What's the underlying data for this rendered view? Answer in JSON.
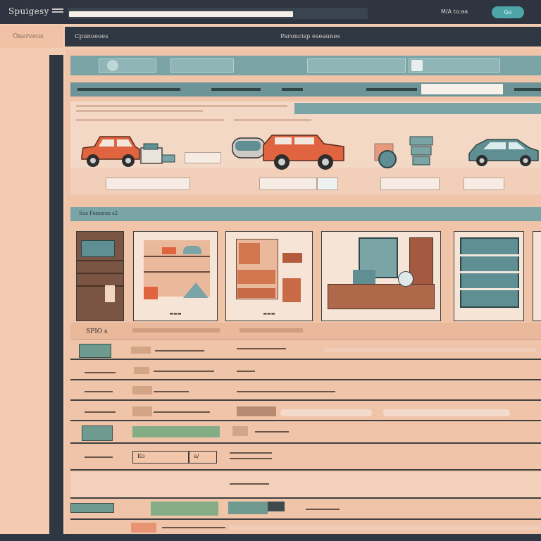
{
  "app": {
    "title": "Spuigesy"
  },
  "topbar": {
    "status_text": "M/A to:aa",
    "button_label": "Go"
  },
  "sidebar": {
    "tab_label": "Onerveus"
  },
  "header": {
    "left_label": "Cpunoeoes",
    "center_label": "Paroncisp eseaunes"
  },
  "category": {
    "label": "Sus Fonoous s2"
  },
  "list": {
    "header_text": "SPIO s",
    "tag_text": "Ko",
    "tag_value": "a/"
  },
  "colors": {
    "topbar": "#2e3540",
    "accent_teal": "#4ea5a8",
    "panel_teal": "#7aa4a6",
    "background_peach": "#f3cdb2",
    "car_orange": "#e0643f",
    "car_teal": "#5f8e93"
  }
}
